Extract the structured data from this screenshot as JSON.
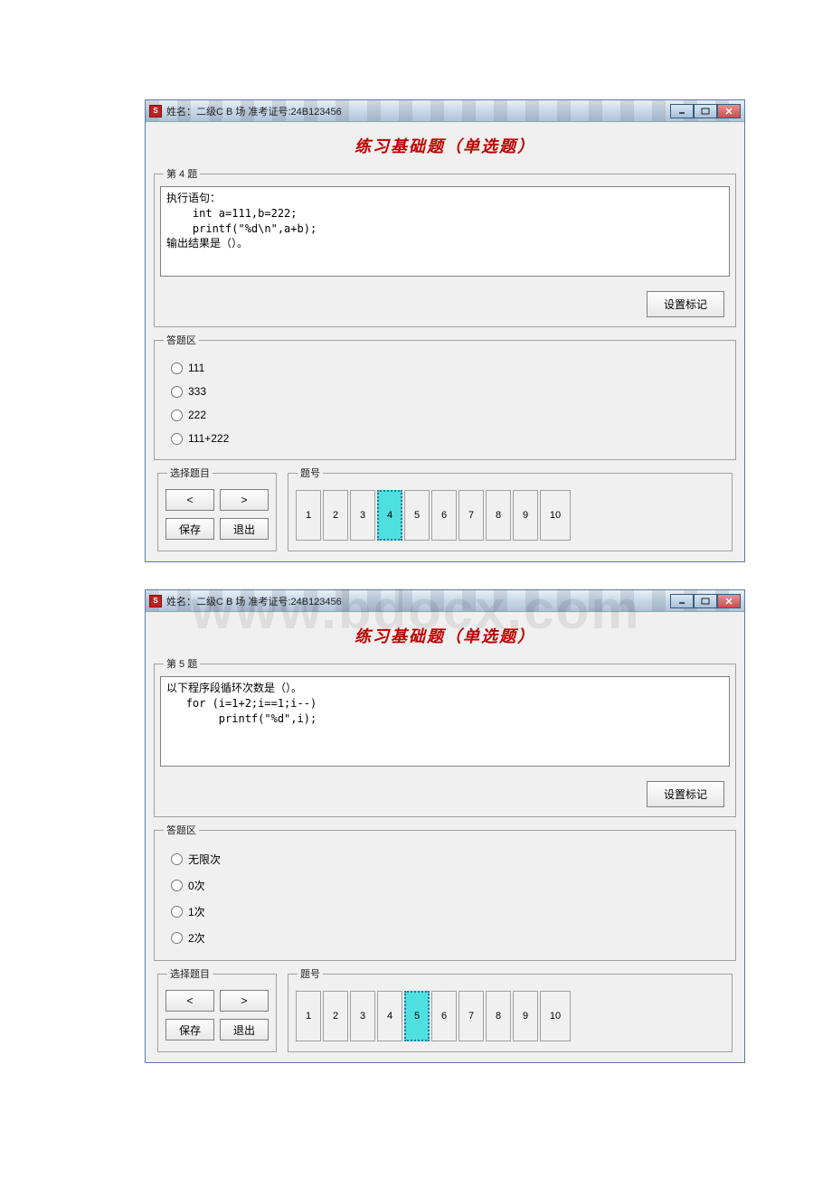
{
  "window1": {
    "title": "姓名：二级C B 场    准考证号:24B123456",
    "header": "练习基础题（单选题）",
    "question_legend": "第 4 题",
    "question_text": "执行语句：\n    int a=111,b=222;\n    printf(\"%d\\n\",a+b);\n输出结果是（）。",
    "mark_button": "设置标记",
    "answer_legend": "答题区",
    "options": [
      "111",
      "333",
      "222",
      "111+222"
    ],
    "select_legend": "选择题目",
    "num_legend": "题号",
    "prev": "<",
    "next": ">",
    "save": "保存",
    "exit": "退出",
    "numbers": [
      "1",
      "2",
      "3",
      "4",
      "5",
      "6",
      "7",
      "8",
      "9",
      "10"
    ],
    "active_index": 3
  },
  "window2": {
    "title": "姓名：二级C B 场    准考证号:24B123456",
    "header": "练习基础题（单选题）",
    "question_legend": "第 5 题",
    "question_text": "以下程序段循环次数是（）。\n   for (i=1+2;i==1;i--)\n        printf(\"%d\",i);",
    "mark_button": "设置标记",
    "answer_legend": "答题区",
    "options": [
      "无限次",
      "0次",
      "1次",
      "2次"
    ],
    "select_legend": "选择题目",
    "num_legend": "题号",
    "prev": "<",
    "next": ">",
    "save": "保存",
    "exit": "退出",
    "numbers": [
      "1",
      "2",
      "3",
      "4",
      "5",
      "6",
      "7",
      "8",
      "9",
      "10"
    ],
    "active_index": 4
  }
}
